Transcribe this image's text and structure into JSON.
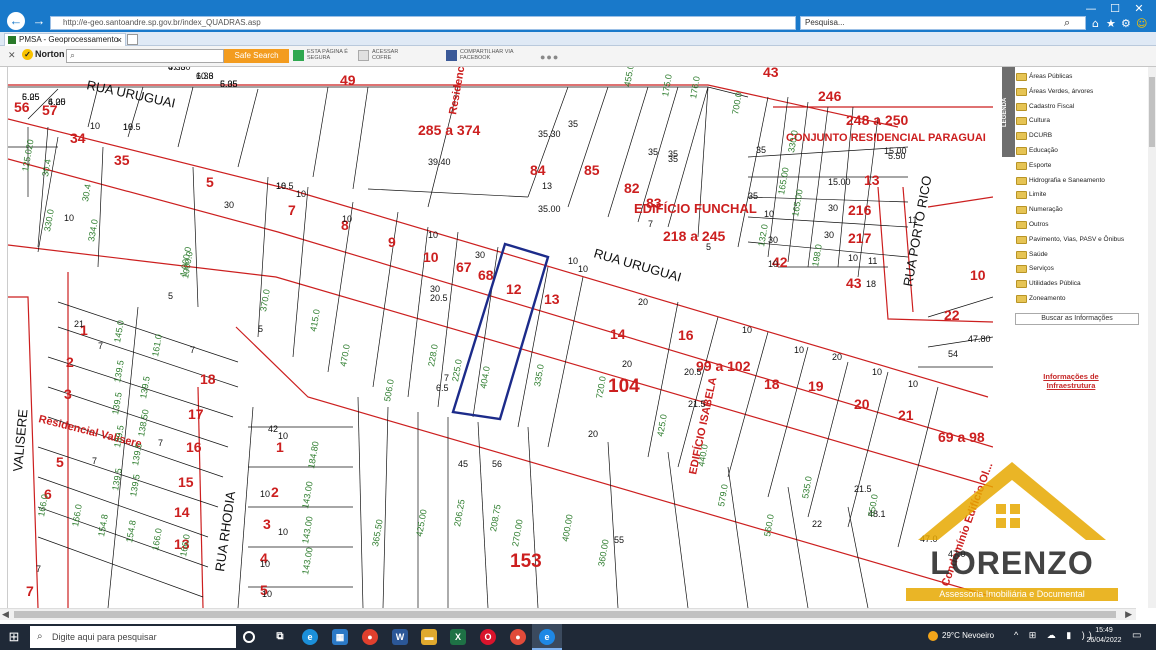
{
  "browser": {
    "url": "http://e-geo.santoandre.sp.gov.br/index_QUADRAS.asp",
    "search_placeholder": "Pesquisa...",
    "tab_title": "PMSA - Geoprocessamento",
    "window_controls": [
      "—",
      "☐",
      "✕"
    ]
  },
  "norton": {
    "brand": "Norton",
    "safe_search_label": "Safe Search",
    "tools": [
      {
        "line1": "ESTA PÁGINA É",
        "line2": "SEGURA"
      },
      {
        "line1": "ACESSAR",
        "line2": "COFRE"
      },
      {
        "line1": "COMPARTILHAR VIA",
        "line2": "FACEBOOK"
      }
    ]
  },
  "legend": {
    "tab_label": "LEGENDA",
    "items": [
      "Áreas Públicas",
      "Áreas Verdes, árvores",
      "Cadastro Fiscal",
      "Cultura",
      "DCURB",
      "Educação",
      "Esporte",
      "Hidrografia e Saneamento",
      "Limite",
      "Numeração",
      "Outros",
      "Pavimento, Vias, PASV e Ônibus",
      "Saúde",
      "Serviços",
      "Utilidades Pública",
      "Zoneamento"
    ],
    "search_button": "Buscar as Informações",
    "infra_link": "Informações de Infraestrutura"
  },
  "map": {
    "streets": [
      "RUA URUGUAI",
      "RUA URUGUAI",
      "RUA PORTO RICO",
      "RUA RHODIA",
      "VALISERE"
    ],
    "buildings": [
      "Residencial Monteviedo",
      "EDIFÍCIO FUNCHAL",
      "CONJUNTO RESIDENCIAL PARAGUAI",
      "Residencial Valisere",
      "EDIFÍCIO ISABELA",
      "Condomínio Edifício Ol..."
    ],
    "highlighted_lot": "12",
    "lot_numbers": [
      {
        "t": "56"
      },
      {
        "t": "57"
      },
      {
        "t": "34"
      },
      {
        "t": "35"
      },
      {
        "t": "5"
      },
      {
        "t": "7"
      },
      {
        "t": "8"
      },
      {
        "t": "9"
      },
      {
        "t": "10"
      },
      {
        "t": "67"
      },
      {
        "t": "68"
      },
      {
        "t": "12"
      },
      {
        "t": "13"
      },
      {
        "t": "14"
      },
      {
        "t": "16"
      },
      {
        "t": "104"
      },
      {
        "t": "99 a 102"
      },
      {
        "t": "18"
      },
      {
        "t": "19"
      },
      {
        "t": "20"
      },
      {
        "t": "21"
      },
      {
        "t": "69 a 98"
      },
      {
        "t": "49"
      },
      {
        "t": "285 a 374"
      },
      {
        "t": "84"
      },
      {
        "t": "85"
      },
      {
        "t": "82"
      },
      {
        "t": "83"
      },
      {
        "t": "218 a 245"
      },
      {
        "t": "43"
      },
      {
        "t": "246"
      },
      {
        "t": "248 a 250"
      },
      {
        "t": "13"
      },
      {
        "t": "216"
      },
      {
        "t": "217"
      },
      {
        "t": "42"
      },
      {
        "t": "43"
      },
      {
        "t": "10"
      },
      {
        "t": "22"
      },
      {
        "t": "1"
      },
      {
        "t": "2"
      },
      {
        "t": "3"
      },
      {
        "t": "18"
      },
      {
        "t": "17"
      },
      {
        "t": "16"
      },
      {
        "t": "15"
      },
      {
        "t": "14"
      },
      {
        "t": "13"
      },
      {
        "t": "5"
      },
      {
        "t": "6"
      },
      {
        "t": "7"
      },
      {
        "t": "1"
      },
      {
        "t": "2"
      },
      {
        "t": "3"
      },
      {
        "t": "4"
      },
      {
        "t": "5"
      },
      {
        "t": "153"
      },
      {
        "t": "18"
      },
      {
        "t": "19"
      },
      {
        "t": "20"
      }
    ],
    "dims": [
      "6.33",
      "6.33",
      "6.35",
      "6.25",
      "6.25",
      "10",
      "10",
      "10",
      "10",
      "10",
      "30",
      "30",
      "30",
      "5",
      "5",
      "10",
      "10",
      "10",
      "10",
      "20",
      "20",
      "20",
      "39.40",
      "35.30",
      "35",
      "35",
      "35",
      "35",
      "35",
      "35",
      "35.00",
      "13",
      "7",
      "5",
      "10",
      "18",
      "11",
      "11",
      "5.50",
      "15.00",
      "15.00",
      "30",
      "30",
      "30",
      "10",
      "10",
      "10",
      "10",
      "20",
      "10",
      "10",
      "10",
      "10",
      "10",
      "10",
      "10",
      "21",
      "7",
      "7",
      "7",
      "7",
      "7",
      "7",
      "6.5",
      "20.5",
      "20.5",
      "21.5",
      "22",
      "21.5",
      "48.1",
      "47.0",
      "47.0",
      "42",
      "45",
      "56",
      "55",
      "54",
      "47.80",
      "47.80",
      "10.6",
      "5.05",
      "5.05",
      "4.00",
      "16.5",
      "16.5"
    ],
    "areas": [
      "125.020",
      "30.4",
      "30.4",
      "330.0",
      "334.0",
      "1,000.0",
      "370.0",
      "415.0",
      "470.0",
      "506.0",
      "228.0",
      "225.0",
      "404.0",
      "335.0",
      "720.0",
      "425.0",
      "440.0",
      "579.0",
      "560.0",
      "535.0",
      "550.0",
      "145.0",
      "161.0",
      "139.5",
      "139.5",
      "139.5",
      "138.50",
      "139.5",
      "139.5",
      "139.5",
      "139.5",
      "166.0",
      "166.0",
      "154.8",
      "154.8",
      "166.0",
      "166.0",
      "184.80",
      "143.00",
      "143.00",
      "143.00",
      "365.50",
      "425.00",
      "206.25",
      "208.75",
      "270.00",
      "400.00",
      "360.00",
      "455.0",
      "175.0",
      "176.0",
      "700.0",
      "330.0",
      "165.00",
      "165.00",
      "132.0",
      "198.0",
      "1000.0"
    ]
  },
  "watermark": {
    "name": "LORENZO",
    "sub": "Assessoria Imobiliária e Documental"
  },
  "taskbar": {
    "search_placeholder": "Digite aqui para pesquisar",
    "weather": "29°C  Nevoeiro",
    "time": "15:49",
    "date": "26/04/2022",
    "systray": "^ ⊞ ☁ ▮ ))"
  },
  "colors": {
    "accent": "#1979ca",
    "lot": "#cc1f1f",
    "area": "#2e7d2e",
    "highlight": "#1c2b8a"
  }
}
